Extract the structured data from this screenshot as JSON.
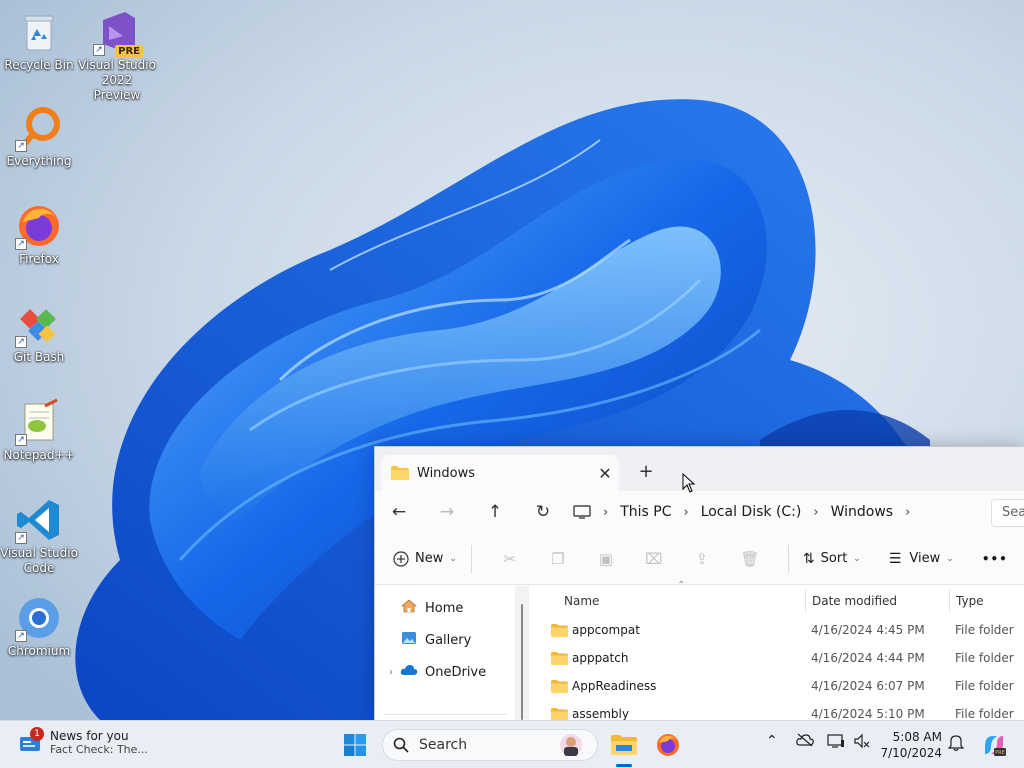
{
  "desktop": {
    "icons": [
      {
        "label": "Recycle Bin"
      },
      {
        "label": "Visual Studio 2022 Preview",
        "badge": "PRE"
      },
      {
        "label": "Everything"
      },
      {
        "label": "Firefox"
      },
      {
        "label": "Git Bash"
      },
      {
        "label": "Notepad++"
      },
      {
        "label": "Visual Studio Code"
      },
      {
        "label": "Chromium"
      }
    ]
  },
  "explorer": {
    "tab_title": "Windows",
    "tab_close": "✕",
    "new_tab": "+",
    "breadcrumbs": [
      "This PC",
      "Local Disk (C:)",
      "Windows"
    ],
    "search_placeholder": "Sea",
    "toolbar": {
      "new_label": "New",
      "sort_label": "Sort",
      "view_label": "View",
      "more_label": "•••"
    },
    "nav_items": [
      {
        "label": "Home"
      },
      {
        "label": "Gallery"
      },
      {
        "label": "OneDrive"
      }
    ],
    "columns": {
      "name": "Name",
      "date": "Date modified",
      "type": "Type"
    },
    "files": [
      {
        "name": "appcompat",
        "date": "4/16/2024 4:45 PM",
        "type": "File folder"
      },
      {
        "name": "apppatch",
        "date": "4/16/2024 4:44 PM",
        "type": "File folder"
      },
      {
        "name": "AppReadiness",
        "date": "4/16/2024 6:07 PM",
        "type": "File folder"
      },
      {
        "name": "assembly",
        "date": "4/16/2024 5:10 PM",
        "type": "File folder"
      }
    ]
  },
  "taskbar": {
    "news_title": "News for you",
    "news_subtitle": "Fact Check: The...",
    "news_badge": "1",
    "search_placeholder": "Search",
    "time": "5:08 AM",
    "date": "7/10/2024"
  },
  "colors": {
    "accent": "#0067c0",
    "folder": "#f8c54a",
    "taskbar": "#e9eef4"
  }
}
